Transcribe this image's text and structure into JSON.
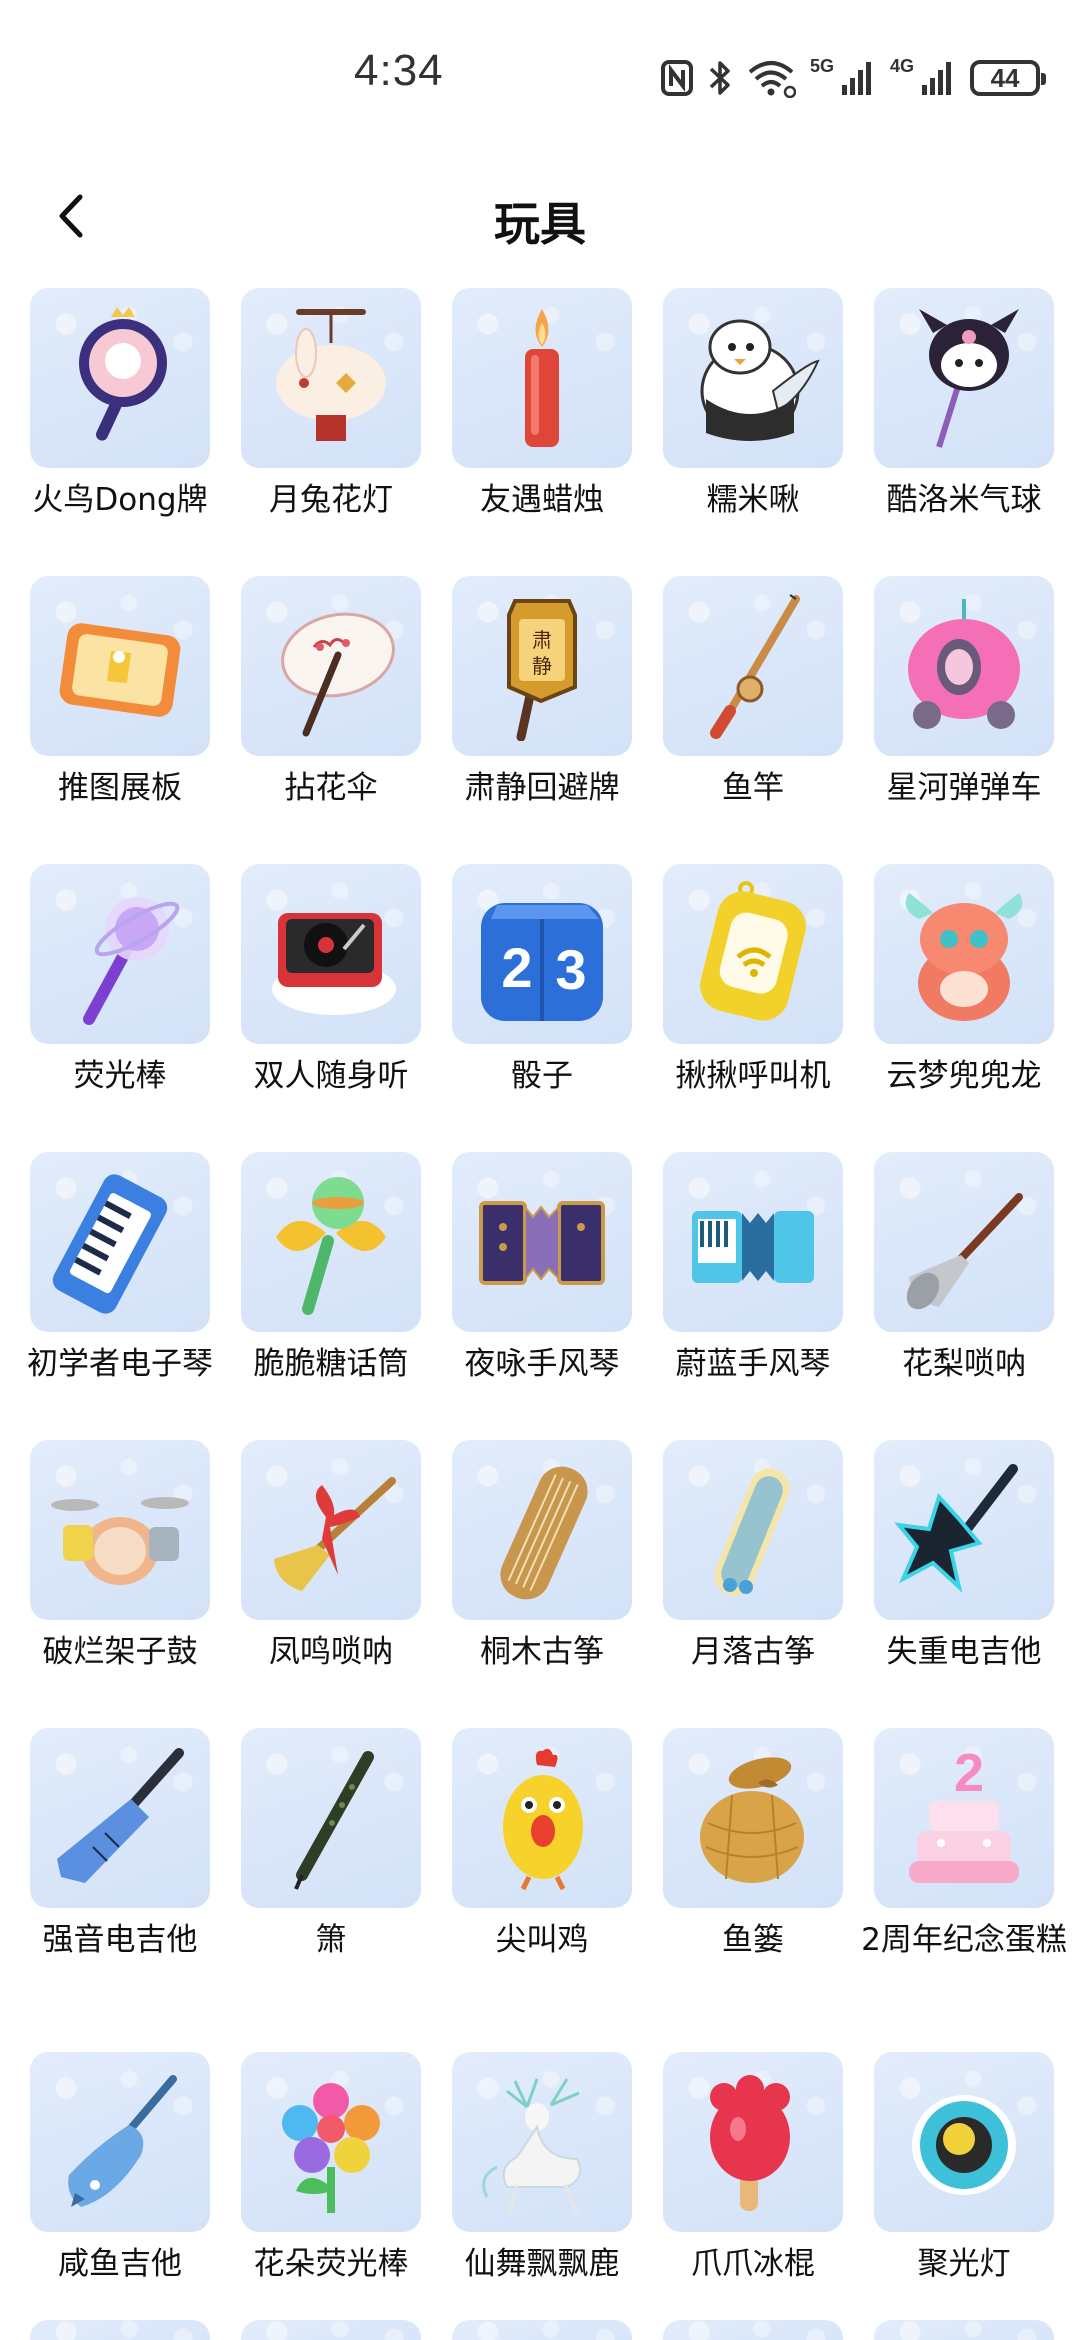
{
  "status_bar": {
    "time": "4:34",
    "network_5g": "5G",
    "network_4g": "4G",
    "battery": "44"
  },
  "header": {
    "title": "玩具"
  },
  "items": [
    {
      "label": "火鸟Dong牌",
      "icon": "fan-paddle-icon"
    },
    {
      "label": "月兔花灯",
      "icon": "rabbit-lantern-icon"
    },
    {
      "label": "友遇蜡烛",
      "icon": "candle-icon"
    },
    {
      "label": "糯米啾",
      "icon": "penguin-icon"
    },
    {
      "label": "酷洛米气球",
      "icon": "kuromi-balloon-icon"
    },
    {
      "label": "推图展板",
      "icon": "display-board-icon"
    },
    {
      "label": "拈花伞",
      "icon": "umbrella-icon"
    },
    {
      "label": "肃静回避牌",
      "icon": "sign-board-icon"
    },
    {
      "label": "鱼竿",
      "icon": "fishing-rod-icon"
    },
    {
      "label": "星河弹弹车",
      "icon": "bumper-car-icon"
    },
    {
      "label": "荧光棒",
      "icon": "glow-stick-icon"
    },
    {
      "label": "双人随身听",
      "icon": "record-player-icon"
    },
    {
      "label": "骰子",
      "icon": "dice-icon"
    },
    {
      "label": "揪揪呼叫机",
      "icon": "pager-icon"
    },
    {
      "label": "云梦兜兜龙",
      "icon": "dragon-icon"
    },
    {
      "label": "初学者电子琴",
      "icon": "keytar-icon"
    },
    {
      "label": "脆脆糖话筒",
      "icon": "candy-microphone-icon"
    },
    {
      "label": "夜咏手风琴",
      "icon": "night-accordion-icon"
    },
    {
      "label": "蔚蓝手风琴",
      "icon": "blue-accordion-icon"
    },
    {
      "label": "花梨唢呐",
      "icon": "suona-icon"
    },
    {
      "label": "破烂架子鼓",
      "icon": "drum-kit-icon"
    },
    {
      "label": "凤鸣唢呐",
      "icon": "phoenix-suona-icon"
    },
    {
      "label": "桐木古筝",
      "icon": "wooden-guzheng-icon"
    },
    {
      "label": "月落古筝",
      "icon": "moon-guzheng-icon"
    },
    {
      "label": "失重电吉他",
      "icon": "star-guitar-icon"
    },
    {
      "label": "强音电吉他",
      "icon": "electric-guitar-icon"
    },
    {
      "label": "箫",
      "icon": "flute-icon"
    },
    {
      "label": "尖叫鸡",
      "icon": "screaming-chicken-icon"
    },
    {
      "label": "鱼篓",
      "icon": "fish-basket-icon"
    },
    {
      "label": "2周年纪念蛋糕",
      "icon": "anniversary-cake-icon"
    },
    {
      "label": "咸鱼吉他",
      "icon": "fish-guitar-icon"
    },
    {
      "label": "花朵荧光棒",
      "icon": "flower-balloon-icon"
    },
    {
      "label": "仙舞飘飘鹿",
      "icon": "deer-icon"
    },
    {
      "label": "爪爪冰棍",
      "icon": "paw-popsicle-icon"
    },
    {
      "label": "聚光灯",
      "icon": "spotlight-icon"
    }
  ],
  "colors": {
    "tile_bg": "#d8e6f9",
    "text": "#111111"
  }
}
